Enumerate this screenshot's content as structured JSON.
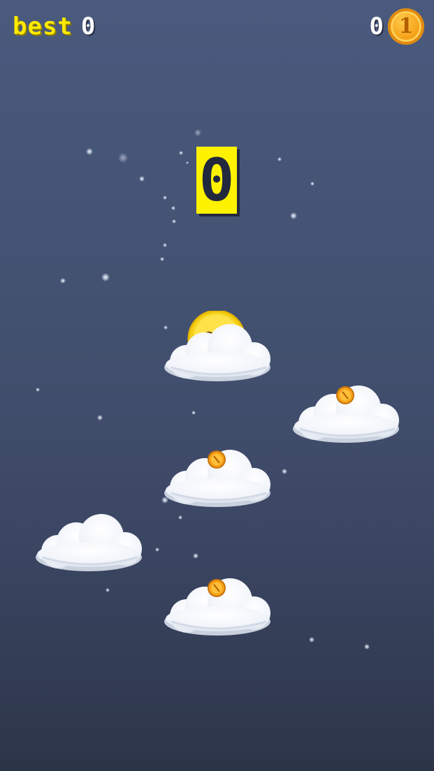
{
  "hud": {
    "best_label": "best",
    "best_value": "0",
    "coin_count": "0",
    "coin_icon_value": "1"
  },
  "score": {
    "current": "0"
  },
  "colors": {
    "best_label": "#ffea00",
    "score_box": "#fff200",
    "coin_gold": "#f5a21a",
    "cloud": "#ffffff"
  },
  "icons": {
    "coin": "coin-icon",
    "cloud": "cloud-platform",
    "player": "smiling-sun-ball"
  }
}
